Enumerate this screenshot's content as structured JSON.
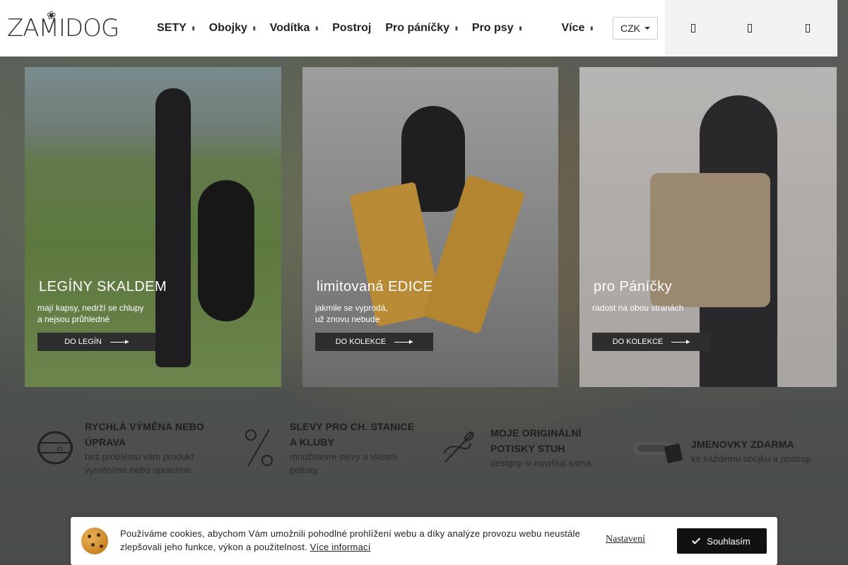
{
  "brand": {
    "logo_text": "ZAMIDOG"
  },
  "nav": {
    "items": [
      {
        "label": "SETY",
        "dropdown": true
      },
      {
        "label": "Obojky",
        "dropdown": true
      },
      {
        "label": "Vodítka",
        "dropdown": true
      },
      {
        "label": "Postroj",
        "dropdown": false
      },
      {
        "label": "Pro páníčky",
        "dropdown": true
      },
      {
        "label": "Pro psy",
        "dropdown": true
      },
      {
        "label": "Více",
        "dropdown": true
      }
    ],
    "currency": "CZK",
    "icons": [
      "search-icon",
      "user-icon",
      "cart-icon"
    ]
  },
  "banners": [
    {
      "title": "LEGÍNY SKALDEM",
      "subtitle_lines": [
        "mají kapsy, nedrží se chlupy",
        "a nejsou průhledné"
      ],
      "button": "DO LEGÍN"
    },
    {
      "title": "limitovaná EDICE",
      "subtitle_lines": [
        "jakmile se vyprodá,",
        "už znovu nebude"
      ],
      "button": "DO KOLEKCE"
    },
    {
      "title": "pro Páníčky",
      "subtitle_lines": [
        "radost na obou stranách"
      ],
      "button": "DO KOLEKCE"
    }
  ],
  "features": [
    {
      "icon": "collar-exchange-icon",
      "title_lines": [
        "RYCHLÁ VÝMĚNA NEBO",
        "ÚPRAVA"
      ],
      "desc_lines": [
        "bez problému vám produkt",
        "vyměníme nebo upravíme"
      ]
    },
    {
      "icon": "percent-icon",
      "title_lines": [
        "SLEVY PRO CH. STANICE",
        "A KLUBY"
      ],
      "desc_lines": [
        "množstevní slevy a vlastní",
        "potisky"
      ]
    },
    {
      "icon": "needle-thread-icon",
      "title_lines": [
        "MOJE ORIGINÁLNÍ",
        "POTISKY STUH"
      ],
      "desc_lines": [
        "designy si navrhuji sama"
      ]
    },
    {
      "icon": "name-tag-collar-icon",
      "title_lines": [
        "JMENOVKY ZDARMA"
      ],
      "desc_lines": [
        "ke každému obojku a postroji"
      ]
    }
  ],
  "cookie": {
    "text": "Používáme cookies, abychom Vám umožnili pohodlné prohlížení webu a díky analýze provozu webu neustále zlepšovali jeho funkce, výkon a použitelnost.",
    "more_link": "Více informací",
    "settings": "Nastavení",
    "accept": "Souhlasím"
  }
}
